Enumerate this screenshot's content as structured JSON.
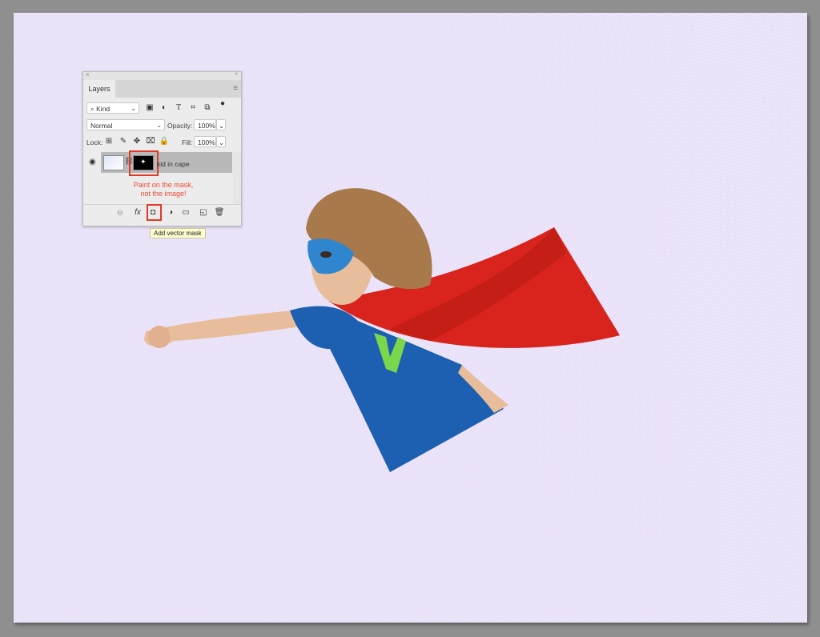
{
  "canvas": {
    "background": "#efe8fb",
    "pasteboard": "#8f8f8f"
  },
  "artwork": {
    "subject": "kid in superhero cape and mask, flying pose",
    "colors": {
      "cape": "#d8241c",
      "shirt": "#1d5fb0",
      "mask": "#2f86cf",
      "hair": "#a8794a",
      "skin": "#e8bd9c",
      "letter": "#7ad64a"
    }
  },
  "layers_panel": {
    "close_icon": "×",
    "collapse_icon": "«",
    "tab_label": "Layers",
    "menu_icon": "≡",
    "filter": {
      "value": "Kind",
      "icon": "⌕"
    },
    "filter_icons": [
      "image-filter-icon",
      "adjustment-filter-icon",
      "type-filter-icon",
      "shape-filter-icon",
      "smart-object-filter-icon"
    ],
    "blend_mode": "Normal",
    "opacity_label": "Opacity:",
    "opacity_value": "100%",
    "lock_label": "Lock:",
    "fill_label": "Fill:",
    "fill_value": "100%",
    "layer": {
      "name": "kid in cape",
      "visible": true
    },
    "annotation": [
      "Paint on the mask,",
      "not the image!"
    ],
    "tooltip": "Add vector mask",
    "highlight_color": "#e33a25"
  }
}
